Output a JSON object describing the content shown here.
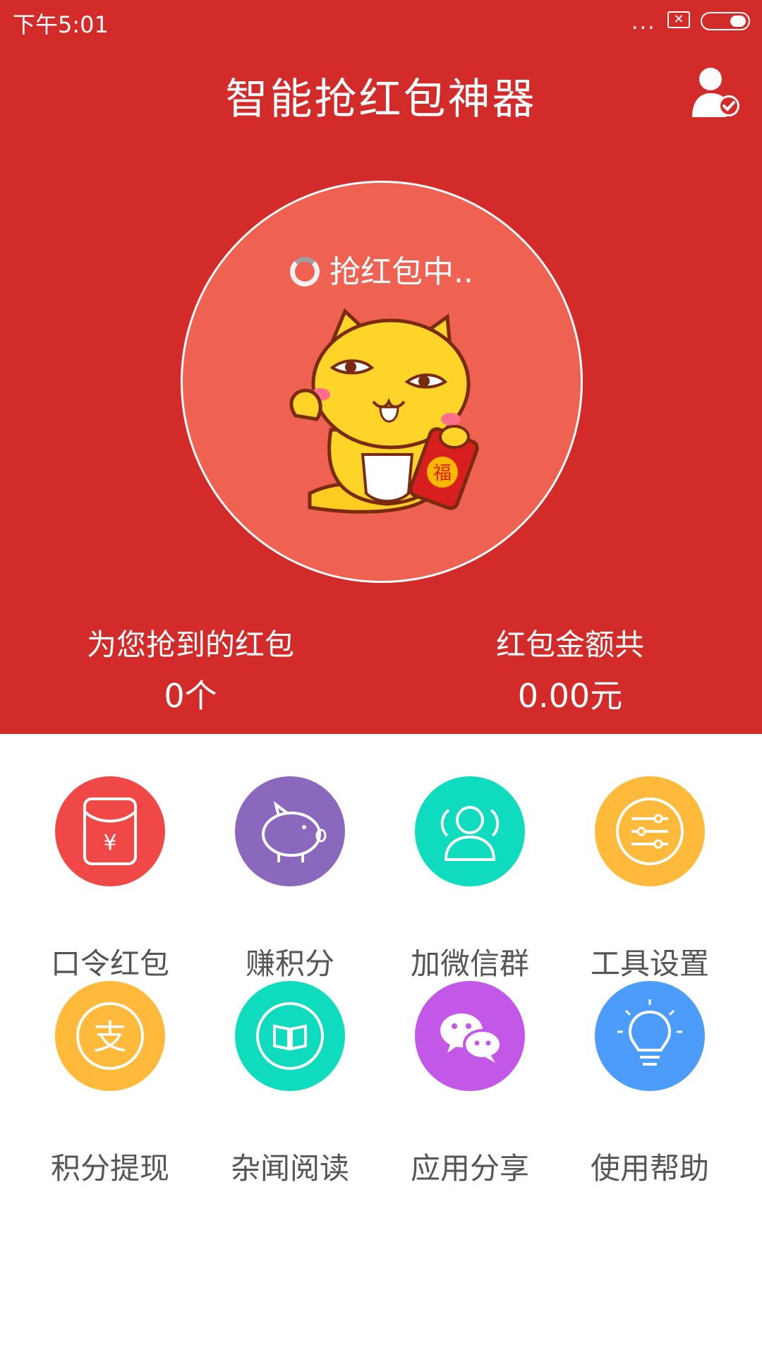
{
  "status_bar": {
    "time": "下午5:01",
    "dots": "..."
  },
  "header": {
    "title": "智能抢红包神器"
  },
  "grab": {
    "status": "抢红包中.."
  },
  "stats": {
    "count_label": "为您抢到的红包",
    "count_value": "0个",
    "amount_label": "红包金额共",
    "amount_value": "0.00元"
  },
  "colors": {
    "brand_red": "#d32a2a",
    "circle": "#ef6150",
    "grid_red": "#f04747",
    "grid_purple": "#8a68bd",
    "grid_teal": "#0fdcbe",
    "grid_yellow": "#ffba3b",
    "grid_violet": "#c257e8",
    "grid_blue": "#4c9cfb"
  },
  "grid": [
    {
      "label": "口令红包",
      "icon": "red-envelope-icon"
    },
    {
      "label": "赚积分",
      "icon": "piggy-bank-icon"
    },
    {
      "label": "加微信群",
      "icon": "group-icon"
    },
    {
      "label": "工具设置",
      "icon": "settings-sliders-icon"
    },
    {
      "label": "积分提现",
      "icon": "alipay-icon"
    },
    {
      "label": "杂闻阅读",
      "icon": "book-icon"
    },
    {
      "label": "应用分享",
      "icon": "wechat-icon"
    },
    {
      "label": "使用帮助",
      "icon": "lightbulb-icon"
    }
  ]
}
